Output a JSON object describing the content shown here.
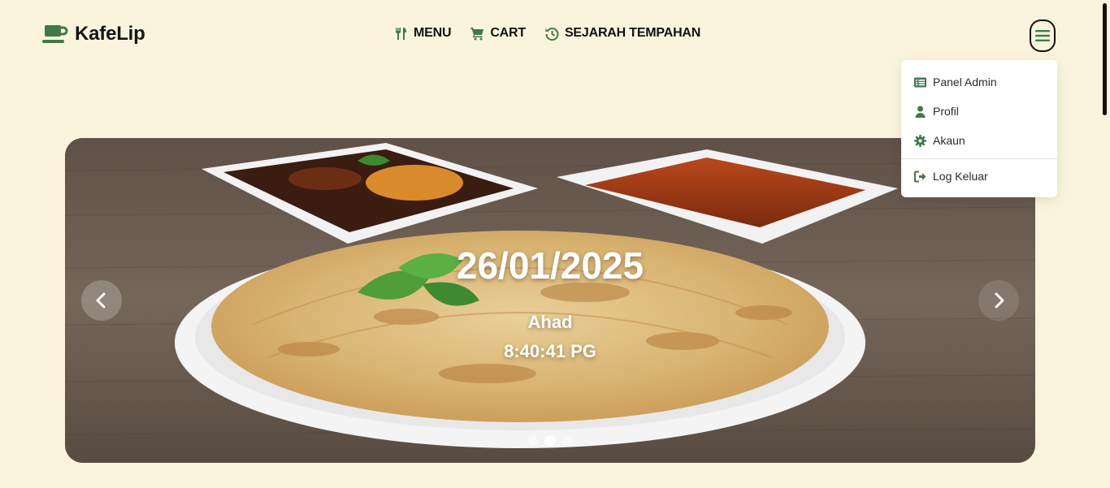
{
  "brand": {
    "name": "KafeLip",
    "icon": "coffee-cup-icon",
    "color": "#3f7a4b"
  },
  "nav": {
    "items": [
      {
        "label": "MENU",
        "icon": "utensils-icon"
      },
      {
        "label": "CART",
        "icon": "cart-icon"
      },
      {
        "label": "SEJARAH TEMPAHAN",
        "icon": "history-icon"
      }
    ]
  },
  "user_menu": {
    "icon": "hamburger-icon",
    "items": [
      {
        "label": "Panel Admin",
        "icon": "list-icon"
      },
      {
        "label": "Profil",
        "icon": "user-icon"
      },
      {
        "label": "Akaun",
        "icon": "gear-icon"
      },
      {
        "label": "Log Keluar",
        "icon": "logout-icon"
      }
    ]
  },
  "carousel": {
    "date": "26/01/2025",
    "day": "Ahad",
    "time": "8:40:41 PG",
    "slide_count": 3,
    "active_slide": 2
  },
  "colors": {
    "background": "#faf4dc",
    "accent": "#3f7a4b",
    "text": "#111111"
  }
}
